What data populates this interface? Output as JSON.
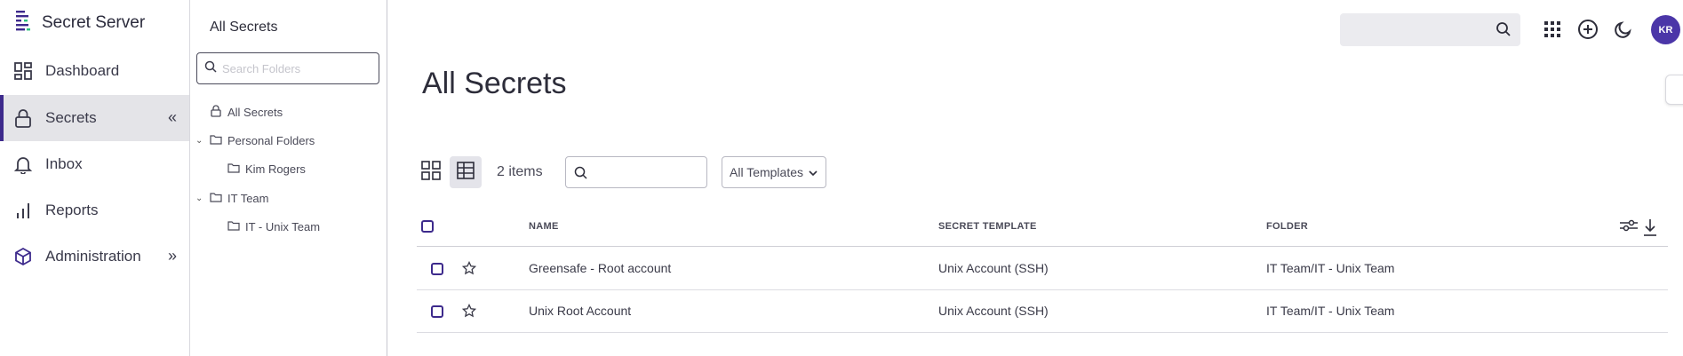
{
  "app": {
    "name": "Secret Server"
  },
  "nav": {
    "items": [
      {
        "label": "Dashboard",
        "icon": "dashboard-icon"
      },
      {
        "label": "Secrets",
        "icon": "lock-icon",
        "active": true
      },
      {
        "label": "Inbox",
        "icon": "bell-icon"
      },
      {
        "label": "Reports",
        "icon": "bar-chart-icon"
      },
      {
        "label": "Administration",
        "icon": "box-icon"
      }
    ]
  },
  "folders": {
    "title": "All Secrets",
    "search_placeholder": "Search Folders",
    "tree": [
      {
        "label": "All Secrets",
        "icon": "lock-icon"
      },
      {
        "label": "Personal Folders",
        "icon": "folder-icon",
        "expanded": true
      },
      {
        "label": "Kim Rogers",
        "icon": "folder-icon"
      },
      {
        "label": "IT Team",
        "icon": "folder-icon",
        "expanded": true
      },
      {
        "label": "IT - Unix Team",
        "icon": "folder-icon"
      }
    ]
  },
  "topbar": {
    "search_value": "",
    "avatar_initials": "KR",
    "icons": [
      "apps-grid-icon",
      "add-circle-icon",
      "moon-icon"
    ]
  },
  "main": {
    "title": "All Secrets",
    "item_count": "2 items",
    "search_value": "",
    "template_filter": "All Templates"
  },
  "table": {
    "headers": [
      "NAME",
      "SECRET TEMPLATE",
      "FOLDER"
    ],
    "rows": [
      {
        "name": "Greensafe - Root account",
        "template": "Unix Account (SSH)",
        "folder": "IT Team/IT - Unix Team"
      },
      {
        "name": "Unix Root Account",
        "template": "Unix Account (SSH)",
        "folder": "IT Team/IT - Unix Team"
      }
    ]
  },
  "colors": {
    "accent": "#3d2a8c",
    "avatar": "#4b36a8",
    "active_nav_bg": "#e4e4e8"
  }
}
